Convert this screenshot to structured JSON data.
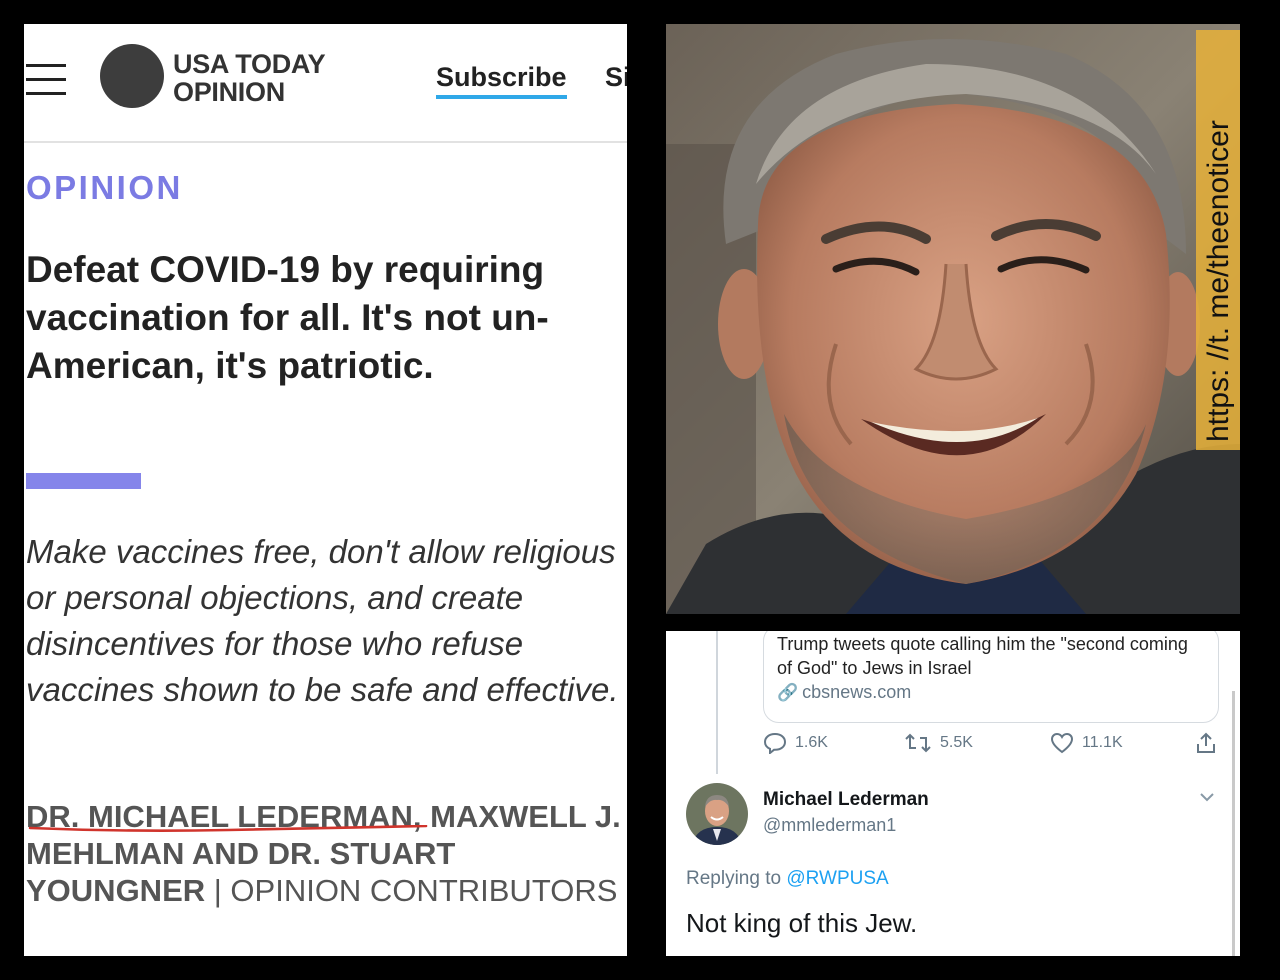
{
  "article": {
    "logo_line1": "USA TODAY",
    "logo_line2": "OPINION",
    "subscribe": "Subscribe",
    "signin": "Sign In",
    "section": "OPINION",
    "headline": "Defeat COVID-19 by requiring vaccination for all. It's not un-American, it's patriotic.",
    "dek": "Make vaccines free, don't allow religious or personal objections, and create disincentives for those who refuse vaccines shown to be safe and effective.",
    "authors_line1_bold": "DR. MICHAEL LEDERMAN, MAXWELL J.",
    "authors_line2_bold": "MEHLMAN AND DR. STUART",
    "authors_line3_bold": "YOUNGNER",
    "authors_sep": " | ",
    "authors_role": "OPINION CONTRIBUTORS",
    "accent": "#7b7be3",
    "underline_color": "#d0342c"
  },
  "photo": {
    "watermark": "https: //t. me/theenoticer"
  },
  "tweet": {
    "card_title": "Trump tweets quote calling him the \"second coming of God\" to Jews in Israel",
    "card_domain": "cbsnews.com",
    "replies": "1.6K",
    "retweets": "5.5K",
    "likes": "11.1K",
    "user_name": "Michael Lederman",
    "user_handle": "@mmlederman1",
    "replying_to_prefix": "Replying to",
    "replying_to_handle": "@RWPUSA",
    "text": "Not king of this Jew.",
    "link_color": "#1da1f2"
  }
}
